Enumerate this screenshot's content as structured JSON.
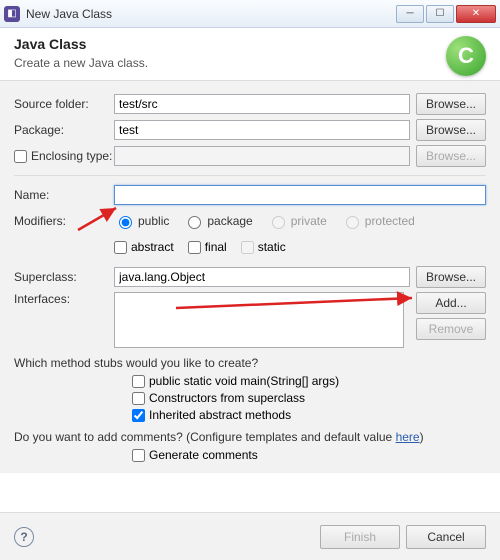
{
  "window": {
    "title": "New Java Class"
  },
  "header": {
    "title": "Java Class",
    "subtitle": "Create a new Java class.",
    "icon_letter": "C"
  },
  "labels": {
    "source_folder": "Source folder:",
    "package": "Package:",
    "enclosing_type": "Enclosing type:",
    "name": "Name:",
    "modifiers": "Modifiers:",
    "superclass": "Superclass:",
    "interfaces": "Interfaces:"
  },
  "values": {
    "source_folder": "test/src",
    "package": "test",
    "enclosing_type": "",
    "name": "",
    "superclass": "java.lang.Object"
  },
  "modifiers": {
    "radios": {
      "public": "public",
      "package": "package",
      "private": "private",
      "protected": "protected"
    },
    "checks": {
      "abstract": "abstract",
      "final": "final",
      "static": "static"
    }
  },
  "buttons": {
    "browse": "Browse...",
    "add": "Add...",
    "remove": "Remove",
    "finish": "Finish",
    "cancel": "Cancel"
  },
  "stubs": {
    "question": "Which method stubs would you like to create?",
    "main": "public static void main(String[] args)",
    "constructors": "Constructors from superclass",
    "inherited": "Inherited abstract methods"
  },
  "comments": {
    "question_prefix": "Do you want to add comments? (Configure templates and default value ",
    "here": "here",
    "question_suffix": ")",
    "generate": "Generate comments"
  }
}
